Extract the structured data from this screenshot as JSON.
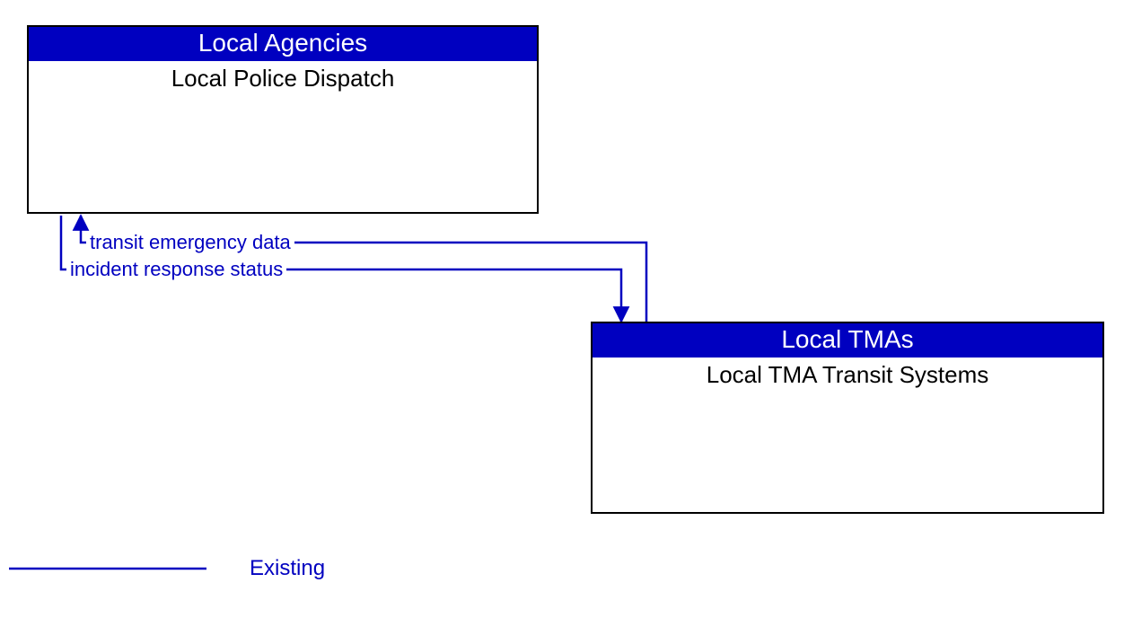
{
  "boxes": {
    "top": {
      "header": "Local Agencies",
      "body": "Local Police Dispatch"
    },
    "bottom": {
      "header": "Local TMAs",
      "body": "Local TMA Transit Systems"
    }
  },
  "flows": {
    "f1": "transit emergency data",
    "f2": "incident response status"
  },
  "legend": {
    "label": "Existing"
  },
  "colors": {
    "line": "#0000c0",
    "header_bg": "#0000c0"
  }
}
